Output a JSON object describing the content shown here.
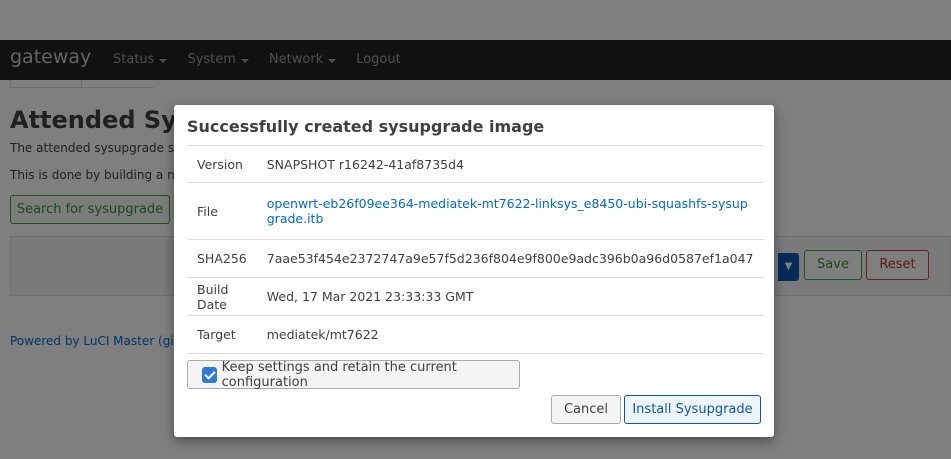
{
  "navbar": {
    "brand": "gateway",
    "menu": [
      {
        "label": "Status",
        "has_dropdown": true
      },
      {
        "label": "System",
        "has_dropdown": true
      },
      {
        "label": "Network",
        "has_dropdown": true
      },
      {
        "label": "Logout",
        "has_dropdown": false
      }
    ]
  },
  "page": {
    "title": "Attended Sysu",
    "desc1": "The attended sysupgrade se",
    "desc2": "This is done by building a ne",
    "search_button": "Search for sysupgrade",
    "save_button": "Save",
    "reset_button": "Reset",
    "footer": "Powered by LuCI Master (git"
  },
  "modal": {
    "title": "Successfully created sysupgrade image",
    "rows": [
      {
        "key": "Version",
        "value": "SNAPSHOT r16242-41af8735d4"
      },
      {
        "key": "File",
        "value": "openwrt-eb26f09ee364-mediatek-mt7622-linksys_e8450-ubi-squashfs-sysupgrade.itb",
        "link": true
      },
      {
        "key": "SHA256",
        "value": "7aae53f454e2372747a9e57f5d236f804e9f800e9adc396b0a96d0587ef1a047"
      },
      {
        "key": "Build Date",
        "value": "Wed, 17 Mar 2021 23:33:33 GMT"
      },
      {
        "key": "Target",
        "value": "mediatek/mt7622"
      }
    ],
    "keep_settings_label": "Keep settings and retain the current configuration",
    "keep_settings_checked": true,
    "cancel_button": "Cancel",
    "install_button": "Install Sysupgrade"
  },
  "colors": {
    "accent": "#0d57b3",
    "link": "#0069d6",
    "navbar": "#222222"
  }
}
